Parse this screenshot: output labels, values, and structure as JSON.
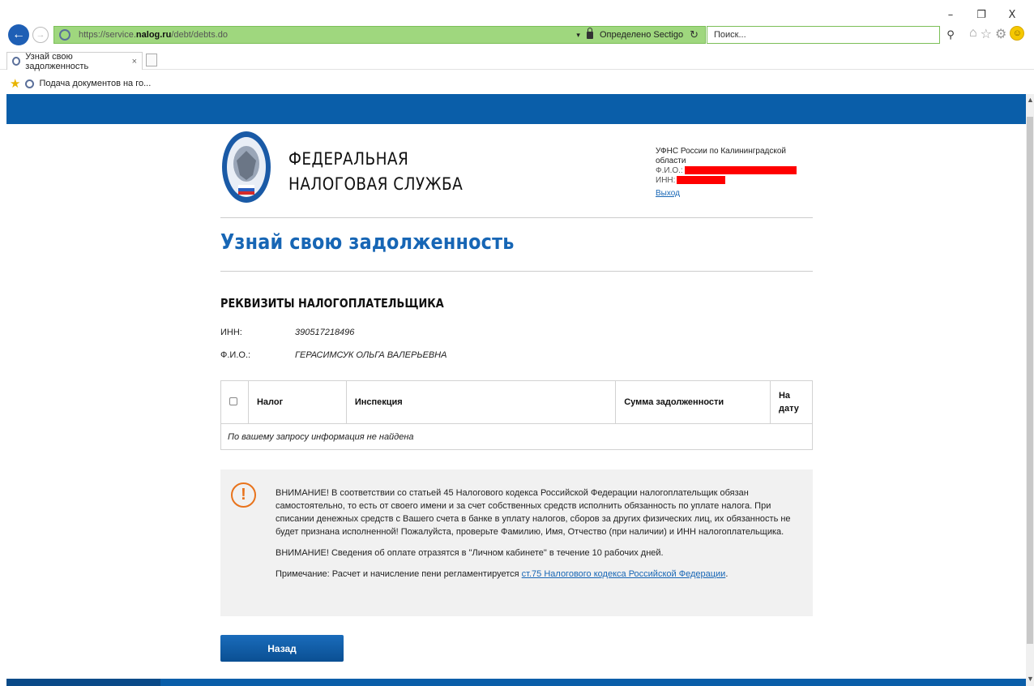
{
  "window": {
    "minimize": "–",
    "maximize": "❐",
    "close": "X"
  },
  "browser": {
    "url_scheme": "https://service.",
    "url_host": "nalog.ru",
    "url_path": "/debt/debts.do",
    "cert_text": "Определено Sectigo",
    "search_placeholder": "Поиск...",
    "tab_title": "Узнай свою задолженность",
    "tab_close": "×",
    "favorite": "Подача документов на го..."
  },
  "header": {
    "brand_line1": "ФЕДЕРАЛЬНАЯ",
    "brand_line2": "НАЛОГОВАЯ СЛУЖБА",
    "office": "УФНС России по Калининградской области",
    "fio_label": "Ф.И.О.:",
    "inn_label": "ИНН:",
    "logout": "Выход"
  },
  "page": {
    "title": "Узнай свою задолженность",
    "section_title": "РЕКВИЗИТЫ НАЛОГОПЛАТЕЛЬЩИКА",
    "inn_label": "ИНН:",
    "inn_value": "390517218496",
    "fio_label": "Ф.И.О.:",
    "fio_value": "ГЕРАСИМСУК ОЛЬГА ВАЛЕРЬЕВНА"
  },
  "table": {
    "col_tax": "Налог",
    "col_inspection": "Инспекция",
    "col_amount": "Сумма задолженности",
    "col_date": "На дату",
    "empty_message": "По вашему запросу информация не найдена"
  },
  "notice": {
    "p1": "ВНИМАНИЕ! В соответствии со статьей 45 Налогового кодекса Российской Федерации налогоплательщик обязан самостоятельно, то есть от своего имени и за счет собственных средств исполнить обязанность по уплате налога. При списании денежных средств с Вашего счета в банке в уплату налогов, сборов за других физических лиц, их обязанность не будет признана исполненной! Пожалуйста, проверьте Фамилию, Имя, Отчество (при наличии) и ИНН налогоплательщика.",
    "p2": "ВНИМАНИЕ! Сведения об оплате отразятся в \"Личном кабинете\" в течение 10 рабочих дней.",
    "p3_prefix": "Примечание: Расчет и начисление пени регламентируется ",
    "p3_link": "ст.75 Налогового кодекса Российской Федерации",
    "p3_suffix": "."
  },
  "buttons": {
    "back": "Назад"
  },
  "colors": {
    "brand_blue": "#0a5ea9",
    "title_blue": "#1766b5",
    "address_green": "#9fd77e",
    "warning_orange": "#e8731c",
    "redaction_red": "#ff0000"
  },
  "icons": {
    "back": "arrow-left-icon",
    "forward": "arrow-right-icon",
    "site": "site-identity-icon",
    "lock": "lock-icon",
    "refresh": "refresh-icon",
    "search": "search-icon",
    "home": "home-icon",
    "favorites": "star-icon",
    "settings": "gear-icon",
    "feedback": "smiley-icon",
    "warning": "exclamation-icon"
  }
}
